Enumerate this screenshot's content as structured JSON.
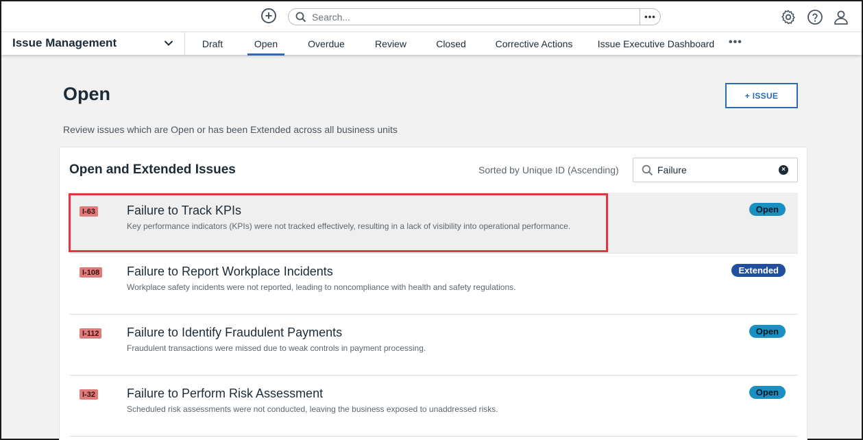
{
  "topbar": {
    "search_placeholder": "Search...",
    "search_more": "•••"
  },
  "nav": {
    "module": "Issue Management",
    "tabs": [
      {
        "label": "Draft"
      },
      {
        "label": "Open"
      },
      {
        "label": "Overdue"
      },
      {
        "label": "Review"
      },
      {
        "label": "Closed"
      },
      {
        "label": "Corrective Actions"
      },
      {
        "label": "Issue Executive Dashboard"
      }
    ],
    "active_tab": "Open",
    "more": "•••"
  },
  "page": {
    "title": "Open",
    "add_button": "+ ISSUE",
    "description": "Review issues which are Open or has been Extended across all business units"
  },
  "card": {
    "title": "Open and Extended Issues",
    "sort_label": "Sorted by Unique ID (Ascending)",
    "filter_value": "Failure",
    "issues": [
      {
        "id": "I-63",
        "title": "Failure to Track KPIs",
        "description": "Key performance indicators (KPIs) were not tracked effectively, resulting in a lack of visibility into operational performance.",
        "status": "Open"
      },
      {
        "id": "I-108",
        "title": "Failure to Report Workplace Incidents",
        "description": "Workplace safety incidents were not reported, leading to noncompliance with health and safety regulations.",
        "status": "Extended"
      },
      {
        "id": "I-112",
        "title": "Failure to Identify Fraudulent Payments",
        "description": "Fraudulent transactions were missed due to weak controls in payment processing.",
        "status": "Open"
      },
      {
        "id": "I-32",
        "title": "Failure to Perform Risk Assessment",
        "description": "Scheduled risk assessments were not conducted, leaving the business exposed to unaddressed risks.",
        "status": "Open"
      }
    ]
  },
  "colors": {
    "accent": "#2a6bb3",
    "status_open": "#1b8fc2",
    "status_extended": "#1f4f9e",
    "id_badge": "#e07b7b",
    "highlight": "#e0383e"
  }
}
